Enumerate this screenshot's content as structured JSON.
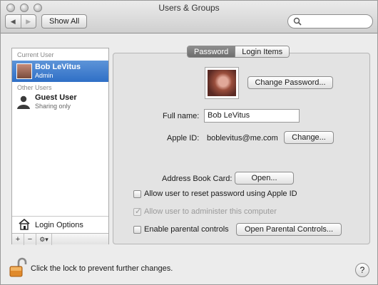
{
  "window": {
    "title": "Users & Groups"
  },
  "toolbar": {
    "back_icon": "chevron-left-icon",
    "forward_icon": "chevron-right-icon",
    "show_all_label": "Show All",
    "search_placeholder": "",
    "search_icon": "magnifier-icon"
  },
  "sidebar": {
    "current_user_header": "Current User",
    "current_user": {
      "name": "Bob LeVitus",
      "role": "Admin"
    },
    "other_users_header": "Other Users",
    "other_users": [
      {
        "name": "Guest User",
        "status": "Sharing only"
      }
    ],
    "login_options_label": "Login Options",
    "add_label": "+",
    "remove_label": "−",
    "gear_label": "⚙▾"
  },
  "tabs": [
    {
      "label": "Password",
      "active": true
    },
    {
      "label": "Login Items",
      "active": false
    }
  ],
  "panel": {
    "change_password_label": "Change Password...",
    "full_name_label": "Full name:",
    "full_name_value": "Bob LeVitus",
    "apple_id_label": "Apple ID:",
    "apple_id_value": "boblevitus@me.com",
    "change_label": "Change...",
    "address_book_label": "Address Book Card:",
    "open_label": "Open...",
    "allow_reset_label": "Allow user to reset password using Apple ID",
    "allow_reset_checked": false,
    "allow_admin_label": "Allow user to administer this computer",
    "allow_admin_checked": true,
    "parental_label": "Enable parental controls",
    "parental_checked": false,
    "open_parental_label": "Open Parental Controls..."
  },
  "footer": {
    "lock_text": "Click the lock to prevent further changes.",
    "help_label": "?"
  }
}
